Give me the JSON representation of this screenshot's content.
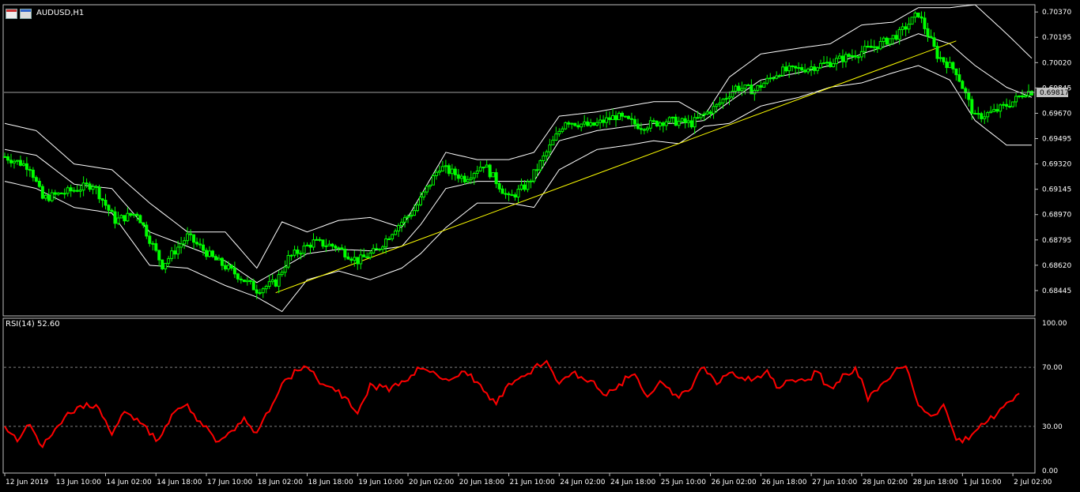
{
  "header": {
    "symbol": "AUDUSD,H1",
    "rsi_label": "RSI(14) 52.60",
    "current_price": "0.69817"
  },
  "colors": {
    "background": "#000000",
    "grid_border": "#c0c0c0",
    "candle": "#00ff00",
    "bollinger": "#ffffff",
    "trendline": "#ffff00",
    "rsi": "#ff0000",
    "current_price_bg": "#c0c0c0"
  },
  "chart_data": [
    {
      "type": "line",
      "subtype": "candlestick",
      "price_axis_ticks": [
        "0.70370",
        "0.70195",
        "0.70020",
        "0.69845",
        "0.69670",
        "0.69495",
        "0.69320",
        "0.69145",
        "0.68970",
        "0.68795",
        "0.68620",
        "0.68445"
      ],
      "ylim": [
        0.6827,
        0.7042
      ],
      "time_axis_labels": [
        "12 Jun 2019",
        "13 Jun 10:00",
        "14 Jun 02:00",
        "14 Jun 18:00",
        "17 Jun 10:00",
        "18 Jun 02:00",
        "18 Jun 18:00",
        "19 Jun 10:00",
        "20 Jun 02:00",
        "20 Jun 18:00",
        "21 Jun 10:00",
        "24 Jun 02:00",
        "24 Jun 18:00",
        "25 Jun 10:00",
        "26 Jun 02:00",
        "26 Jun 18:00",
        "27 Jun 10:00",
        "28 Jun 02:00",
        "28 Jun 18:00",
        "1 Jul 10:00",
        "2 Jul 02:00"
      ],
      "x_label_index": [
        0,
        16,
        32,
        48,
        64,
        80,
        96,
        112,
        128,
        144,
        160,
        176,
        192,
        208,
        224,
        240,
        256,
        272,
        288,
        304,
        320
      ],
      "close_anchors": [
        [
          0,
          0.6937
        ],
        [
          8,
          0.693
        ],
        [
          12,
          0.6908
        ],
        [
          22,
          0.6914
        ],
        [
          28,
          0.6918
        ],
        [
          35,
          0.6893
        ],
        [
          42,
          0.6898
        ],
        [
          50,
          0.6862
        ],
        [
          58,
          0.6882
        ],
        [
          66,
          0.6867
        ],
        [
          74,
          0.6855
        ],
        [
          80,
          0.6845
        ],
        [
          86,
          0.685
        ],
        [
          90,
          0.6867
        ],
        [
          98,
          0.6878
        ],
        [
          105,
          0.6875
        ],
        [
          112,
          0.6865
        ],
        [
          118,
          0.6872
        ],
        [
          124,
          0.6888
        ],
        [
          130,
          0.69
        ],
        [
          138,
          0.693
        ],
        [
          146,
          0.6922
        ],
        [
          152,
          0.6932
        ],
        [
          160,
          0.6908
        ],
        [
          166,
          0.6918
        ],
        [
          172,
          0.694
        ],
        [
          178,
          0.6962
        ],
        [
          186,
          0.6958
        ],
        [
          194,
          0.6965
        ],
        [
          202,
          0.6958
        ],
        [
          210,
          0.6962
        ],
        [
          218,
          0.696
        ],
        [
          226,
          0.6972
        ],
        [
          232,
          0.6985
        ],
        [
          238,
          0.6983
        ],
        [
          246,
          0.6996
        ],
        [
          254,
          0.6998
        ],
        [
          262,
          0.7002
        ],
        [
          270,
          0.7008
        ],
        [
          278,
          0.7015
        ],
        [
          284,
          0.7022
        ],
        [
          290,
          0.7036
        ],
        [
          296,
          0.7007
        ],
        [
          302,
          0.6996
        ],
        [
          308,
          0.6964
        ],
        [
          314,
          0.6968
        ],
        [
          320,
          0.6975
        ],
        [
          324,
          0.6982
        ]
      ],
      "bollinger_bands": {
        "upper": [
          [
            0,
            0.696
          ],
          [
            10,
            0.6955
          ],
          [
            22,
            0.6932
          ],
          [
            34,
            0.6928
          ],
          [
            46,
            0.6905
          ],
          [
            58,
            0.6885
          ],
          [
            70,
            0.6885
          ],
          [
            80,
            0.686
          ],
          [
            88,
            0.6892
          ],
          [
            96,
            0.6885
          ],
          [
            106,
            0.6893
          ],
          [
            116,
            0.6895
          ],
          [
            126,
            0.6888
          ],
          [
            132,
            0.691
          ],
          [
            140,
            0.694
          ],
          [
            150,
            0.6935
          ],
          [
            160,
            0.6935
          ],
          [
            168,
            0.694
          ],
          [
            176,
            0.6965
          ],
          [
            188,
            0.6968
          ],
          [
            198,
            0.6972
          ],
          [
            206,
            0.6975
          ],
          [
            214,
            0.6975
          ],
          [
            222,
            0.6965
          ],
          [
            230,
            0.6992
          ],
          [
            240,
            0.7008
          ],
          [
            252,
            0.7012
          ],
          [
            262,
            0.7015
          ],
          [
            272,
            0.7028
          ],
          [
            282,
            0.703
          ],
          [
            290,
            0.704
          ],
          [
            300,
            0.704
          ],
          [
            308,
            0.7042
          ],
          [
            318,
            0.7022
          ],
          [
            326,
            0.7005
          ]
        ],
        "middle": [
          [
            0,
            0.6942
          ],
          [
            10,
            0.6938
          ],
          [
            22,
            0.6918
          ],
          [
            34,
            0.6915
          ],
          [
            46,
            0.6885
          ],
          [
            58,
            0.6875
          ],
          [
            70,
            0.6865
          ],
          [
            80,
            0.685
          ],
          [
            88,
            0.686
          ],
          [
            96,
            0.687
          ],
          [
            106,
            0.6873
          ],
          [
            116,
            0.6872
          ],
          [
            126,
            0.6875
          ],
          [
            132,
            0.689
          ],
          [
            140,
            0.6915
          ],
          [
            150,
            0.692
          ],
          [
            160,
            0.692
          ],
          [
            168,
            0.692
          ],
          [
            176,
            0.6948
          ],
          [
            188,
            0.6955
          ],
          [
            198,
            0.6958
          ],
          [
            206,
            0.696
          ],
          [
            214,
            0.696
          ],
          [
            222,
            0.6962
          ],
          [
            230,
            0.6975
          ],
          [
            240,
            0.699
          ],
          [
            252,
            0.6995
          ],
          [
            262,
            0.7
          ],
          [
            272,
            0.7008
          ],
          [
            282,
            0.7015
          ],
          [
            290,
            0.7022
          ],
          [
            300,
            0.7015
          ],
          [
            308,
            0.7
          ],
          [
            318,
            0.6985
          ],
          [
            326,
            0.6978
          ]
        ],
        "lower": [
          [
            0,
            0.692
          ],
          [
            10,
            0.6915
          ],
          [
            22,
            0.6902
          ],
          [
            34,
            0.6898
          ],
          [
            46,
            0.6862
          ],
          [
            58,
            0.686
          ],
          [
            70,
            0.6848
          ],
          [
            80,
            0.684
          ],
          [
            88,
            0.683
          ],
          [
            96,
            0.6852
          ],
          [
            106,
            0.6858
          ],
          [
            116,
            0.6852
          ],
          [
            126,
            0.686
          ],
          [
            132,
            0.687
          ],
          [
            140,
            0.6888
          ],
          [
            150,
            0.6905
          ],
          [
            160,
            0.6905
          ],
          [
            168,
            0.6902
          ],
          [
            176,
            0.6928
          ],
          [
            188,
            0.6942
          ],
          [
            198,
            0.6945
          ],
          [
            206,
            0.6948
          ],
          [
            214,
            0.6946
          ],
          [
            222,
            0.6958
          ],
          [
            230,
            0.696
          ],
          [
            240,
            0.6972
          ],
          [
            252,
            0.6978
          ],
          [
            262,
            0.6985
          ],
          [
            272,
            0.6988
          ],
          [
            282,
            0.6995
          ],
          [
            290,
            0.7
          ],
          [
            300,
            0.699
          ],
          [
            308,
            0.6962
          ],
          [
            318,
            0.6945
          ],
          [
            326,
            0.6945
          ]
        ]
      },
      "trendline": [
        [
          86,
          0.6843
        ],
        [
          302,
          0.7017
        ]
      ]
    },
    {
      "type": "line",
      "title": "RSI(14) 52.60",
      "ylim": [
        0,
        100
      ],
      "y_ticks": [
        "100.00",
        "70.00",
        "30.00",
        "0.00"
      ],
      "levels": [
        70,
        30
      ],
      "rsi_anchors": [
        [
          0,
          30
        ],
        [
          4,
          22
        ],
        [
          8,
          31
        ],
        [
          12,
          16
        ],
        [
          16,
          27
        ],
        [
          20,
          37
        ],
        [
          24,
          44
        ],
        [
          30,
          42
        ],
        [
          34,
          24
        ],
        [
          38,
          40
        ],
        [
          44,
          33
        ],
        [
          48,
          20
        ],
        [
          54,
          40
        ],
        [
          58,
          45
        ],
        [
          62,
          32
        ],
        [
          68,
          20
        ],
        [
          72,
          27
        ],
        [
          76,
          34
        ],
        [
          80,
          26
        ],
        [
          84,
          40
        ],
        [
          88,
          58
        ],
        [
          92,
          67
        ],
        [
          96,
          70
        ],
        [
          100,
          60
        ],
        [
          104,
          55
        ],
        [
          108,
          50
        ],
        [
          112,
          38
        ],
        [
          116,
          58
        ],
        [
          122,
          56
        ],
        [
          128,
          63
        ],
        [
          132,
          69
        ],
        [
          136,
          66
        ],
        [
          140,
          60
        ],
        [
          146,
          66
        ],
        [
          150,
          60
        ],
        [
          156,
          45
        ],
        [
          160,
          60
        ],
        [
          164,
          62
        ],
        [
          168,
          70
        ],
        [
          172,
          73
        ],
        [
          176,
          60
        ],
        [
          180,
          66
        ],
        [
          186,
          61
        ],
        [
          190,
          52
        ],
        [
          196,
          60
        ],
        [
          200,
          66
        ],
        [
          204,
          50
        ],
        [
          208,
          60
        ],
        [
          214,
          50
        ],
        [
          218,
          58
        ],
        [
          222,
          70
        ],
        [
          226,
          60
        ],
        [
          230,
          68
        ],
        [
          234,
          63
        ],
        [
          238,
          60
        ],
        [
          242,
          66
        ],
        [
          246,
          56
        ],
        [
          250,
          63
        ],
        [
          254,
          60
        ],
        [
          258,
          67
        ],
        [
          262,
          55
        ],
        [
          266,
          64
        ],
        [
          270,
          70
        ],
        [
          274,
          50
        ],
        [
          278,
          58
        ],
        [
          282,
          66
        ],
        [
          286,
          71
        ],
        [
          290,
          45
        ],
        [
          294,
          37
        ],
        [
          298,
          44
        ],
        [
          302,
          22
        ],
        [
          306,
          21
        ],
        [
          310,
          31
        ],
        [
          314,
          36
        ],
        [
          318,
          46
        ],
        [
          322,
          52.6
        ]
      ]
    }
  ]
}
